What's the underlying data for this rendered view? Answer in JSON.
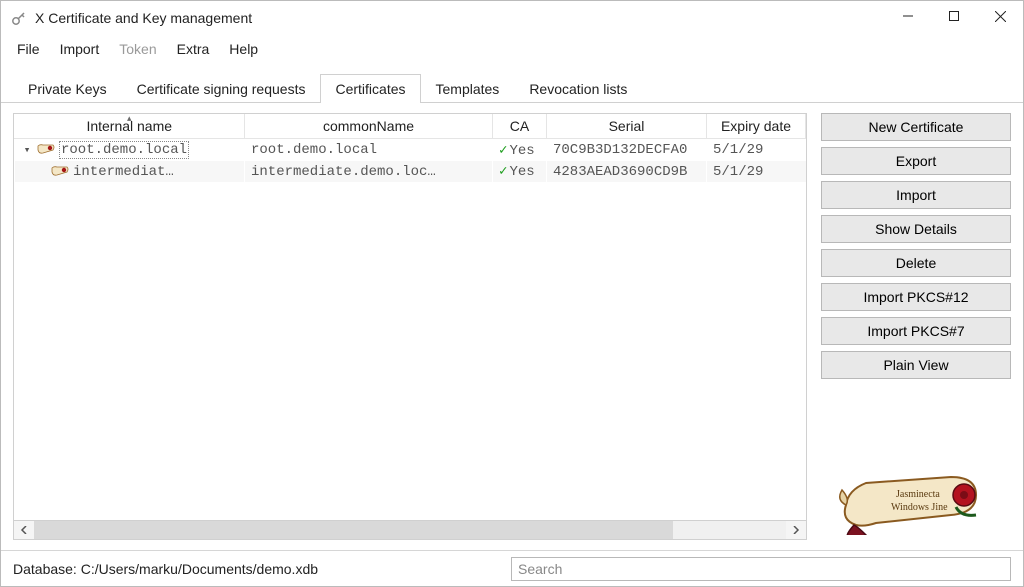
{
  "window": {
    "title": "X Certificate and Key management"
  },
  "menu": {
    "items": [
      {
        "label": "File",
        "enabled": true
      },
      {
        "label": "Import",
        "enabled": true
      },
      {
        "label": "Token",
        "enabled": false
      },
      {
        "label": "Extra",
        "enabled": true
      },
      {
        "label": "Help",
        "enabled": true
      }
    ]
  },
  "tabs": {
    "items": [
      {
        "label": "Private Keys"
      },
      {
        "label": "Certificate signing requests"
      },
      {
        "label": "Certificates"
      },
      {
        "label": "Templates"
      },
      {
        "label": "Revocation lists"
      }
    ],
    "active_index": 2
  },
  "columns": {
    "internal_name": "Internal name",
    "common_name": "commonName",
    "ca": "CA",
    "serial": "Serial",
    "expiry": "Expiry date"
  },
  "rows": [
    {
      "indent": 0,
      "expandable": true,
      "expanded": true,
      "selected": true,
      "internal_name": "root.demo.local",
      "common_name": "root.demo.local",
      "ca": "Yes",
      "serial": "70C9B3D132DECFA0",
      "expiry": "5/1/29"
    },
    {
      "indent": 1,
      "expandable": false,
      "expanded": false,
      "selected": false,
      "internal_name": "intermediat…",
      "common_name": "intermediate.demo.loc…",
      "ca": "Yes",
      "serial": "4283AEAD3690CD9B",
      "expiry": "5/1/29"
    }
  ],
  "actions": {
    "new_certificate": "New Certificate",
    "export": "Export",
    "import": "Import",
    "show_details": "Show Details",
    "delete": "Delete",
    "import_pkcs12": "Import PKCS#12",
    "import_pkcs7": "Import PKCS#7",
    "plain_view": "Plain View"
  },
  "status": {
    "database_label": "Database:",
    "database_path": "C:/Users/marku/Documents/demo.xdb",
    "search_placeholder": "Search"
  }
}
